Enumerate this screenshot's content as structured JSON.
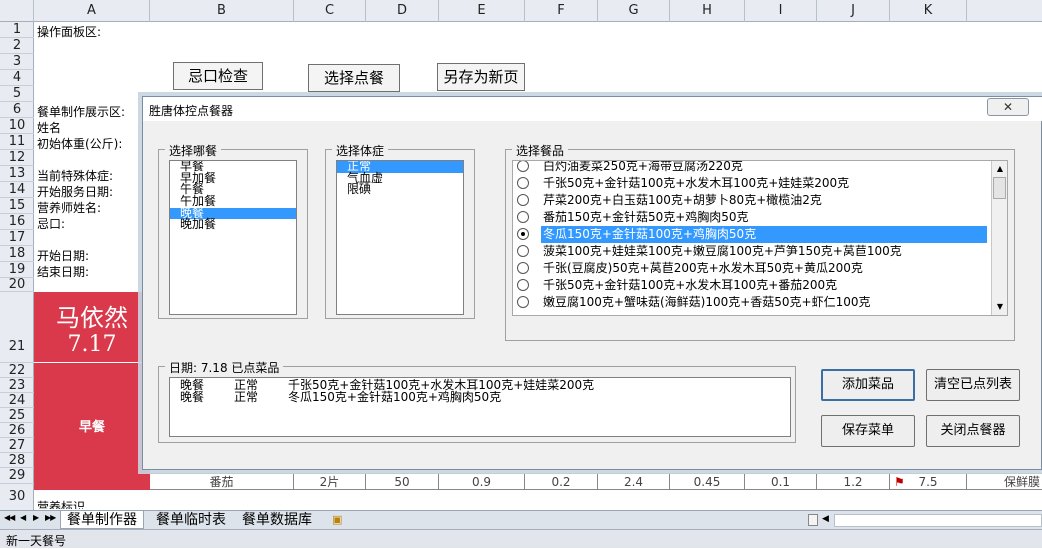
{
  "columns": [
    "A",
    "B",
    "C",
    "D",
    "E",
    "F",
    "G",
    "H",
    "I",
    "J",
    "K"
  ],
  "rows": [
    "1",
    "2",
    "3",
    "4",
    "5",
    "6",
    "10",
    "11",
    "12",
    "13",
    "14",
    "15",
    "16",
    "17",
    "18",
    "19",
    "20",
    "21",
    "22",
    "23",
    "24",
    "25",
    "26",
    "27",
    "28",
    "29",
    "30"
  ],
  "sheet": {
    "a1": "操作面板区:",
    "a6": "餐单制作展示区:",
    "a10": "姓名",
    "a11": "初始体重(公斤):",
    "a13": "当前特殊体症:",
    "a14": "开始服务日期:",
    "a15": "营养师姓名:",
    "a16": "忌口:",
    "a18": "开始日期:",
    "a19": "结束日期:",
    "a30": "营养标识"
  },
  "sheet_buttons": {
    "check": "忌口检查",
    "select": "选择点餐",
    "saveas": "另存为新页"
  },
  "panel": {
    "name": "马依然",
    "date": "7.17",
    "meal": "早餐"
  },
  "row29": [
    "番茄",
    "2片",
    "50",
    "0.9",
    "0.2",
    "2.4",
    "0.45",
    "0.1",
    "1.2",
    "7.5",
    "保鲜膜"
  ],
  "dialog": {
    "title": "胜唐体控点餐器",
    "close_glyph": "✕",
    "meal_time_label": "选择哪餐",
    "meal_times": [
      "早餐",
      "早加餐",
      "午餐",
      "午加餐",
      "晚餐",
      "晚加餐"
    ],
    "meal_time_selected": 4,
    "condition_label": "选择体症",
    "conditions": [
      "正常",
      "气血虚",
      "限碘"
    ],
    "condition_selected": 0,
    "meal_label": "选择餐品",
    "meals": [
      "白灼油麦菜250克+海带豆腐汤220克",
      "千张50克+金针菇100克+水发木耳100克+娃娃菜200克",
      "芹菜200克+白玉菇100克+胡萝卜80克+橄榄油2克",
      "番茄150克+金针菇50克+鸡胸肉50克",
      "冬瓜150克+金针菇100克+鸡胸肉50克",
      "菠菜100克+娃娃菜100克+嫩豆腐100克+芦笋150克+莴苣100克",
      "千张(豆腐皮)50克+莴苣200克+水发木耳50克+黄瓜200克",
      "千张50克+金针菇100克+水发木耳100克+番茄200克",
      "嫩豆腐100克+蟹味菇(海鲜菇)100克+香菇50克+虾仁100克"
    ],
    "meal_selected": 4,
    "ordered_label": "日期: 7.18  已点菜品",
    "ordered": [
      {
        "time": "晚餐",
        "cond": "正常",
        "dish": "千张50克+金针菇100克+水发木耳100克+娃娃菜200克"
      },
      {
        "time": "晚餐",
        "cond": "正常",
        "dish": "冬瓜150克+金针菇100克+鸡胸肉50克"
      }
    ],
    "buttons": {
      "add": "添加菜品",
      "clear": "清空已点列表",
      "save": "保存菜单",
      "close": "关闭点餐器"
    }
  },
  "tabs": [
    "餐单制作器",
    "餐单临时表",
    "餐单数据库"
  ],
  "tab_nav": [
    "◀◀",
    "◀",
    "▶",
    "▶▶"
  ],
  "status": "新一天餐号"
}
